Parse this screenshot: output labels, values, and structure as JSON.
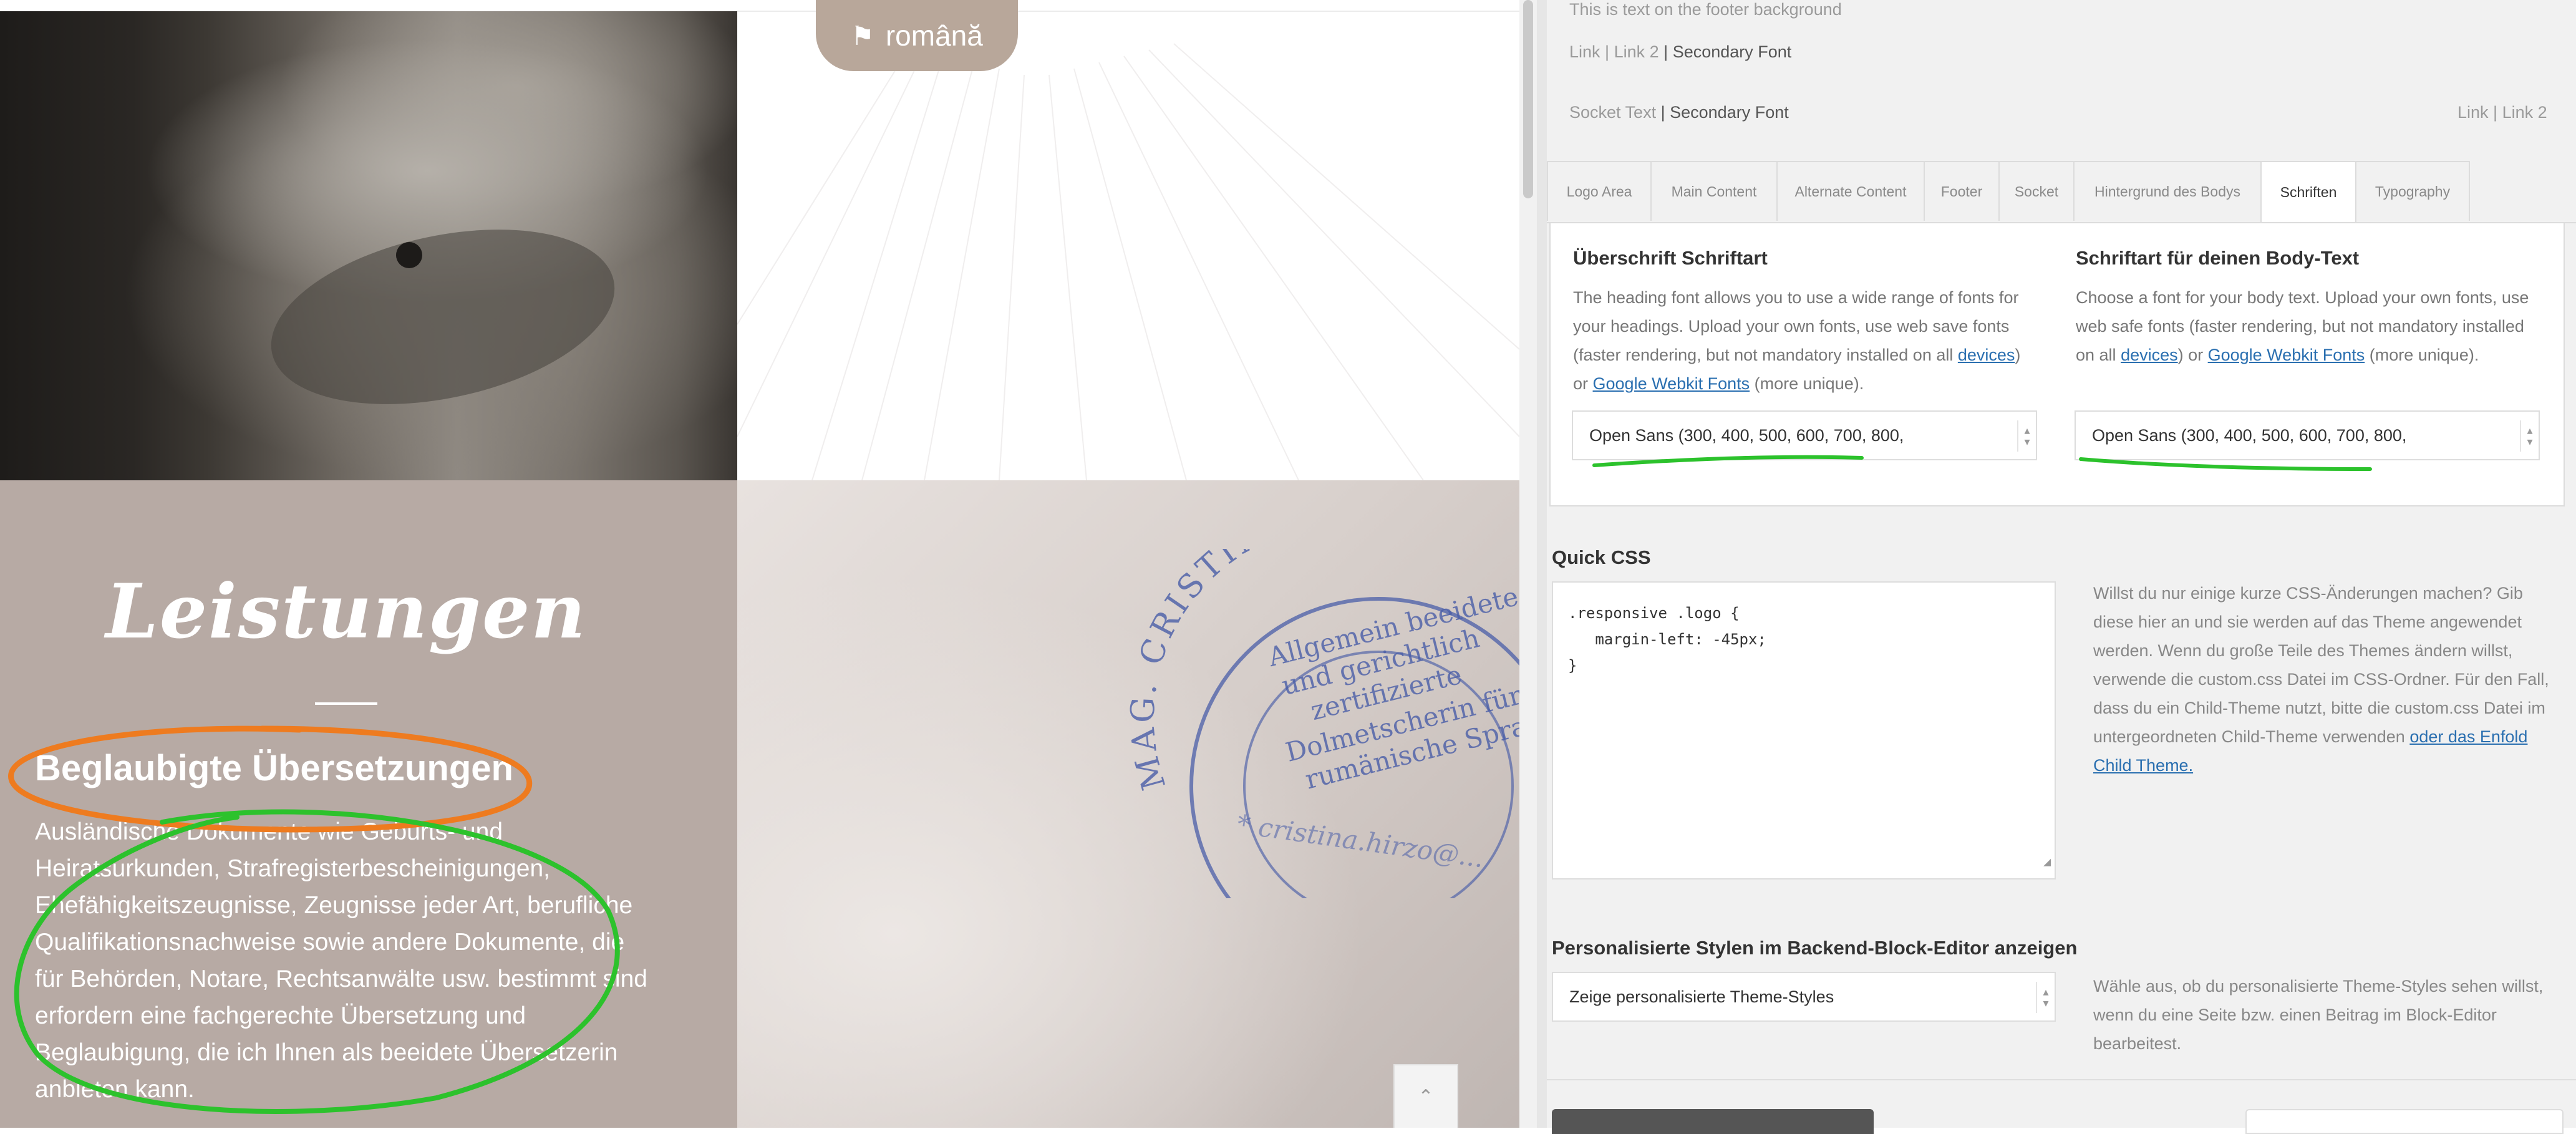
{
  "site": {
    "language_button": "română",
    "services_title": "Leistungen",
    "service_heading": "Beglaubigte Übersetzungen",
    "service_text": "Ausländische Dokumente wie Geburts- und Heiratsurkunden, Strafregisterbescheinigungen, Ehefähigkeitszeugnisse, Zeugnisse jeder Art, berufliche Qualifikationsnachweise sowie andere Dokumente, die für Behörden, Notare, Rechtsanwälte usw. bestimmt sind erfordern eine fachgerechte Übersetzung und Beglaubigung, die ich Ihnen als beeidete Übersetzerin anbieten kann.",
    "stamp": {
      "ring_text": "MAG. CRISTINA HIRZO",
      "lines": [
        "Allgemein beeidete",
        "und gerichtlich",
        "zertifizierte",
        "Dolmetscherin für die",
        "rumänische Sprache"
      ],
      "bottom_text": "* cristina.hirzo@..."
    }
  },
  "panel": {
    "footer_text": "This is text on the footer background",
    "footer_links": {
      "link1": "Link",
      "sep1": "|",
      "link2": "Link 2",
      "sep2": "|",
      "secondary": "Secondary Font"
    },
    "socket": {
      "text": "Socket Text",
      "sep": "|",
      "secondary": "Secondary Font",
      "link1": "Link",
      "sep2": "|",
      "link2": "Link 2"
    },
    "tabs": [
      {
        "label": "Logo Area"
      },
      {
        "label": "Main Content"
      },
      {
        "label": "Alternate Content"
      },
      {
        "label": "Footer"
      },
      {
        "label": "Socket"
      },
      {
        "label": "Hintergrund des Bodys"
      },
      {
        "label": "Schriften"
      },
      {
        "label": "Typography"
      }
    ],
    "heading_font": {
      "title": "Überschrift Schriftart",
      "desc_pre": "The heading font allows you to use a wide range of fonts for your headings. Upload your own fonts, use web save fonts (faster rendering, but not mandatory installed on all ",
      "link_devices": "devices",
      "desc_mid": ") or ",
      "link_google": "Google Webkit Fonts",
      "desc_post": " (more unique).",
      "value": "Open Sans (300, 400, 500, 600, 700, 800,"
    },
    "body_font": {
      "title": "Schriftart für deinen Body-Text",
      "desc_pre": "Choose a font for your body text. Upload your own fonts, use web safe fonts (faster rendering, but not mandatory installed on all ",
      "link_devices": "devices",
      "desc_mid": ") or ",
      "link_google": "Google Webkit Fonts",
      "desc_post": " (more unique).",
      "value": "Open Sans (300, 400, 500, 600, 700, 800,"
    },
    "quick_css": {
      "label": "Quick CSS",
      "code": ".responsive .logo {\n   margin-left: -45px;\n}",
      "help_pre": "Willst du nur einige kurze CSS-Änderungen machen? Gib diese hier an und sie werden auf das Theme angewendet werden. Wenn du große Teile des Themes ändern willst, verwende die custom.css Datei im CSS-Ordner. Für den Fall, dass du ein Child-Theme nutzt, bitte die custom.css Datei im untergeordneten Child-Theme verwenden ",
      "help_link": "oder das Enfold Child Theme."
    },
    "block_editor": {
      "label": "Personalisierte Stylen im Backend-Block-Editor anzeigen",
      "value": "Zeige personalisierte Theme-Styles",
      "help": "Wähle aus, ob du personalisierte Theme-Styles sehen willst, wenn du eine Seite bzw. einen Beitrag im Block-Editor bearbeitest."
    }
  },
  "icons": {
    "scroll_top": "chevron-up-icon",
    "language": "signpost-icon"
  },
  "colors": {
    "accent_button": "#b8a79a",
    "services_bg": "#b7aaa4",
    "link": "#2a6fb0",
    "annotation_orange": "#ee7b1f",
    "annotation_green": "#2cc22c",
    "stamp_ink": "#4a5ea8"
  }
}
